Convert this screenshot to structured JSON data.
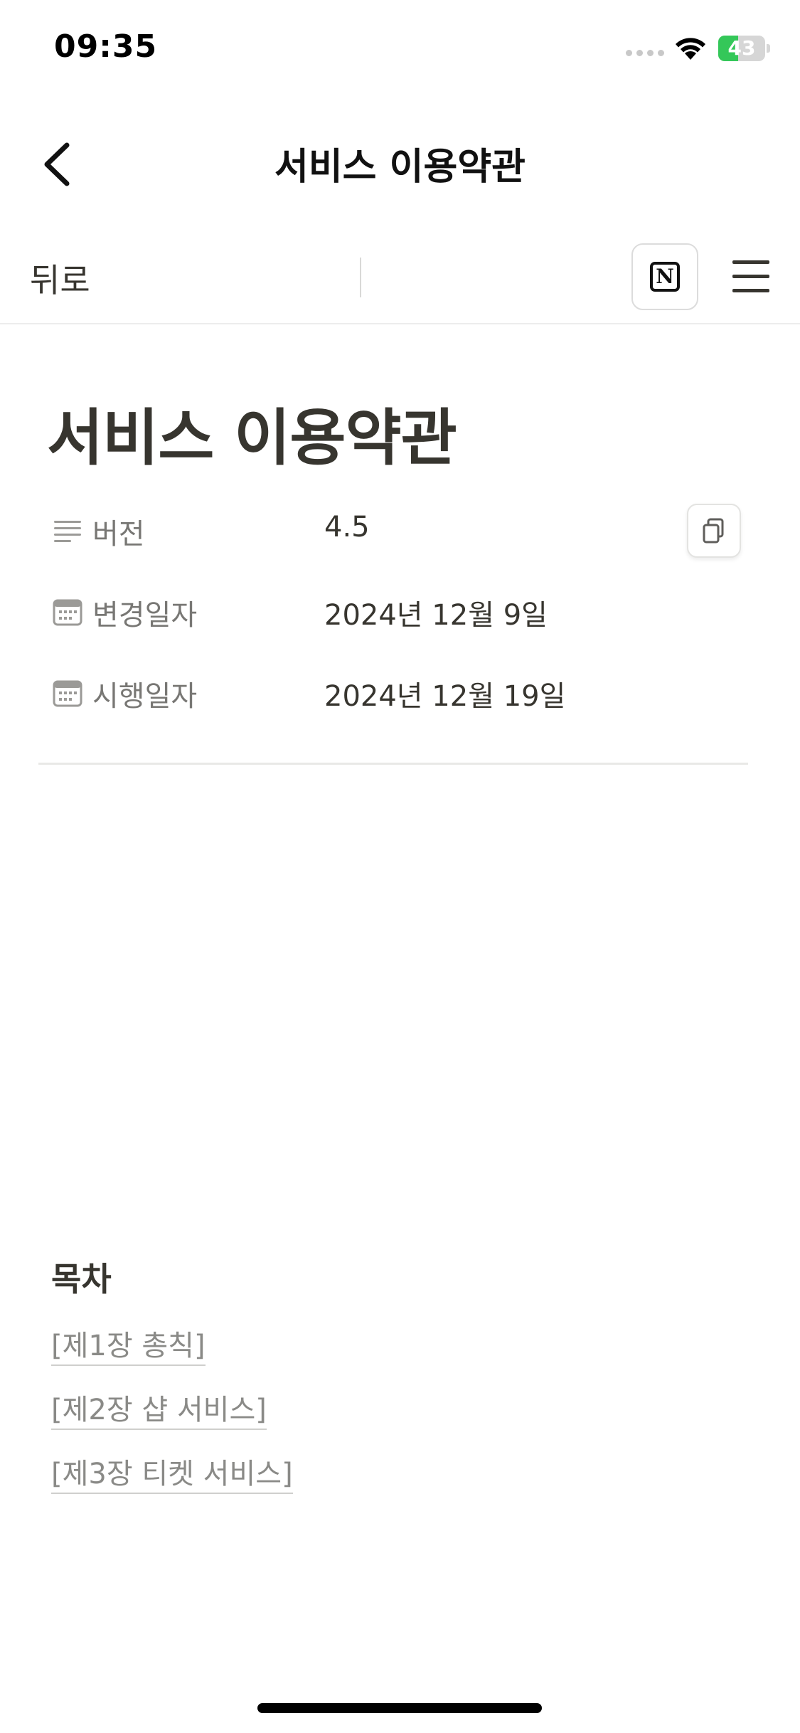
{
  "status_bar": {
    "time": "09:35",
    "battery_level": "43",
    "battery_percent": 43,
    "battery_color": "#34c759"
  },
  "nav": {
    "title": "서비스 이용약관",
    "back_icon": "chevron-left-icon"
  },
  "toolbar": {
    "back_label": "뒤로",
    "notion_logo_letter": "N",
    "menu_icon": "hamburger-menu-icon"
  },
  "page": {
    "title": "서비스 이용약관",
    "properties": [
      {
        "icon": "text-lines-icon",
        "label": "버전",
        "value": "4.5"
      },
      {
        "icon": "calendar-icon",
        "label": "변경일자",
        "value": "2024년 12월 9일"
      },
      {
        "icon": "calendar-icon",
        "label": "시행일자",
        "value": "2024년 12월 19일"
      }
    ],
    "copy_icon": "copy-icon"
  },
  "toc": {
    "heading": "목차",
    "items": [
      "[제1장 총칙]",
      "[제2장 샵 서비스]",
      "[제3장 티켓 서비스]"
    ]
  }
}
